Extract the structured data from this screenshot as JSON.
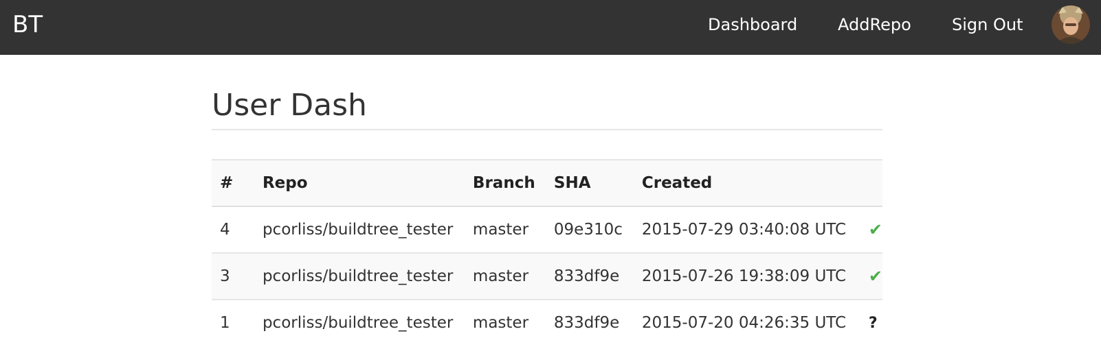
{
  "navbar": {
    "brand": "BT",
    "links": [
      {
        "label": "Dashboard"
      },
      {
        "label": "AddRepo"
      },
      {
        "label": "Sign Out"
      }
    ],
    "avatar_icon": "user-avatar"
  },
  "main": {
    "title": "User Dash",
    "table": {
      "headers": [
        "#",
        "Repo",
        "Branch",
        "SHA",
        "Created",
        ""
      ],
      "rows": [
        {
          "num": "4",
          "repo": "pcorliss/buildtree_tester",
          "branch": "master",
          "sha": "09e310c",
          "created": "2015-07-29 03:40:08 UTC",
          "status": "✔",
          "status_icon": "check-icon"
        },
        {
          "num": "3",
          "repo": "pcorliss/buildtree_tester",
          "branch": "master",
          "sha": "833df9e",
          "created": "2015-07-26 19:38:09 UTC",
          "status": "✔",
          "status_icon": "check-icon"
        },
        {
          "num": "1",
          "repo": "pcorliss/buildtree_tester",
          "branch": "master",
          "sha": "833df9e",
          "created": "2015-07-20 04:26:35 UTC",
          "status": "?",
          "status_icon": "question-icon"
        }
      ]
    }
  },
  "colors": {
    "navbar_bg": "#333333",
    "success": "#4cae4c",
    "stripe": "#f9f9f9"
  }
}
